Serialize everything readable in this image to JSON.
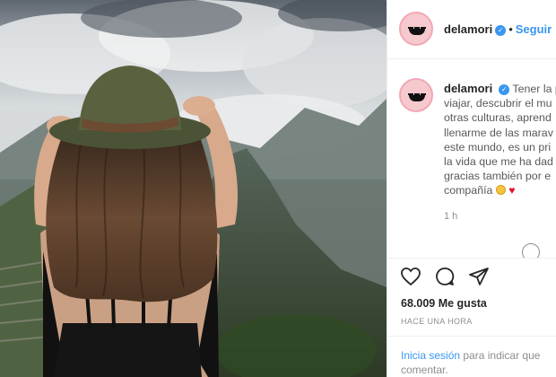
{
  "post": {
    "username": "delamori",
    "follow_label": "Seguir",
    "dot": "•",
    "verified_glyph": "✓",
    "caption_lines": [
      "Tener la p",
      "viajar, descubrir el mu",
      "otras culturas, aprend",
      "llenarme de las marav",
      "este mundo, es un pri",
      "la vida que me ha dad",
      "gracias también por e",
      "compañía"
    ],
    "heart_glyph": "♥",
    "time_label": "1 h",
    "likes": "68.009 Me gusta",
    "posted_ago": "HACE UNA HORA",
    "login_link": "Inicia sesión",
    "login_text": " para indicar que",
    "login_text2": "comentar."
  },
  "icons": [
    "like-heart-icon",
    "comment-icon",
    "share-icon",
    "verified-badge-icon"
  ],
  "colors": {
    "accent": "#3897f0",
    "heart": "#e0112b",
    "text": "#262626",
    "muted": "#8e8e8e"
  }
}
